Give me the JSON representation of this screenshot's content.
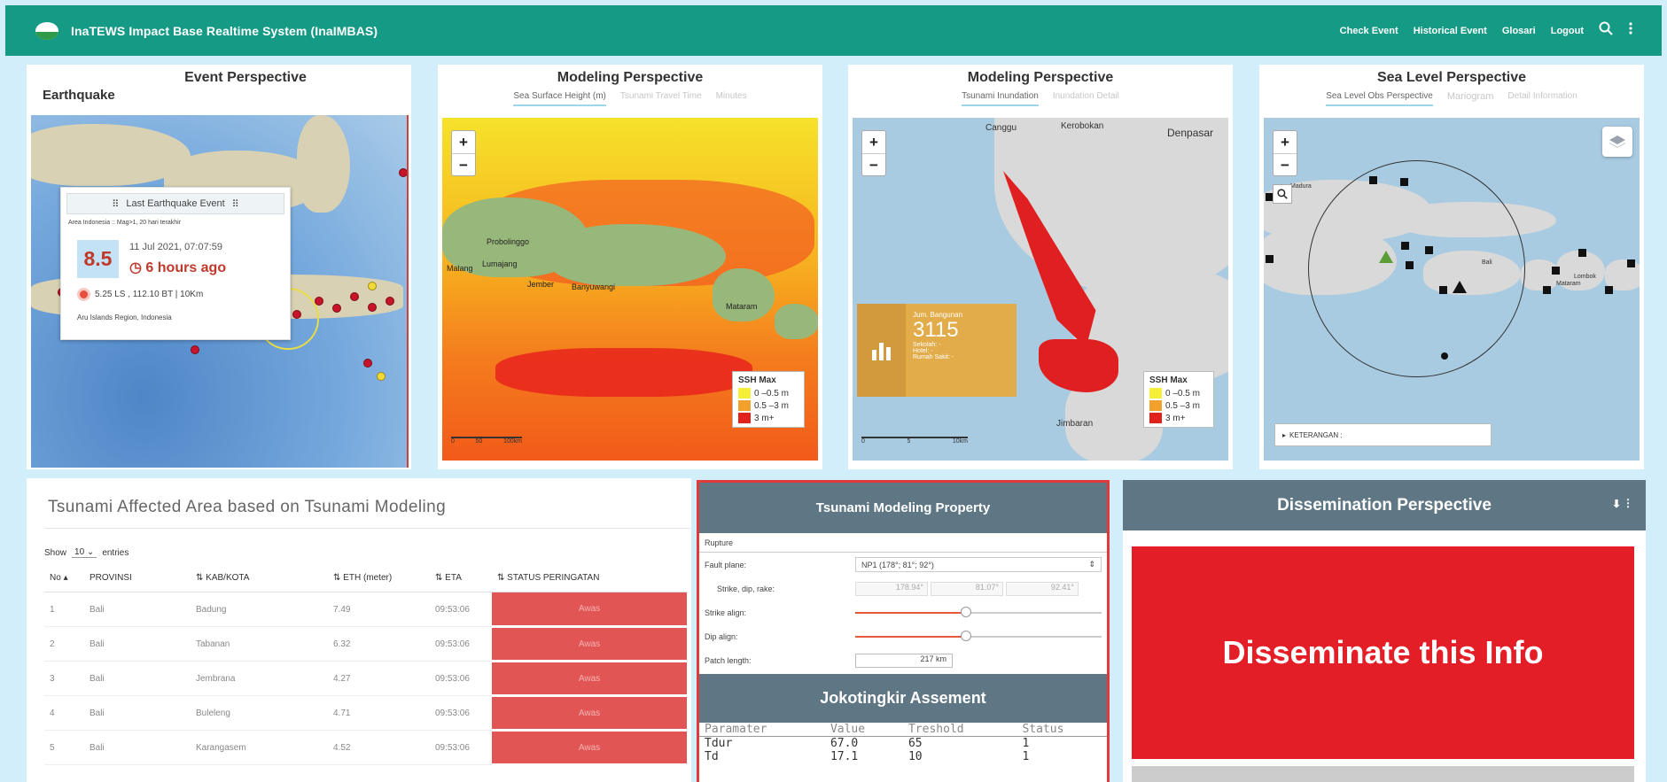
{
  "app": {
    "title": "InaTEWS Impact Base Realtime System (InaIMBAS)",
    "nav": [
      "Check Event",
      "Historical Event",
      "Glosari",
      "Logout"
    ]
  },
  "event_perspective": {
    "title": "Event Perspective",
    "tab": "Earthquake",
    "popup": {
      "header": "Last Earthquake Event",
      "subtitle": "Area Indonesia :: Mag>1, 20 hari terakhir",
      "magnitude": "8.5",
      "datetime": "11 Jul 2021, 07:07:59",
      "ago": "6 hours ago",
      "location": "5.25 LS , 112.10 BT | 10Km",
      "region": "Aru Islands Region, Indonesia"
    }
  },
  "modeling_ssh": {
    "title": "Modeling Perspective",
    "tabs": [
      "Sea Surface Height (m)",
      "Tsunami Travel Time",
      "Minutes"
    ],
    "places": [
      "Probolinggo",
      "Lumajang",
      "Jember",
      "Banyuwangi",
      "Mataram",
      "Malang"
    ],
    "legend": {
      "title": "SSH Max",
      "items": [
        "0 –0.5 m",
        "0.5 –3 m",
        "3 m+"
      ]
    },
    "scale_labels": [
      "0",
      "50",
      "100km"
    ]
  },
  "modeling_inundation": {
    "title": "Modeling Perspective",
    "tabs": [
      "Tsunami Inundation",
      "Inundation Detail"
    ],
    "places": [
      "Canggu",
      "Kerobokan",
      "Denpasar",
      "Jimbaran"
    ],
    "stat": {
      "label": "Jum. Bangunan",
      "value": "3115",
      "lines": [
        "Sekolah: -",
        "Hotel: -",
        "Rumah Sakit: -"
      ]
    },
    "legend": {
      "title": "SSH Max",
      "items": [
        "0 –0.5 m",
        "0.5 –3 m",
        "3 m+"
      ]
    },
    "scale_labels": [
      "0",
      "5",
      "10km"
    ]
  },
  "sea_level": {
    "title": "Sea Level Perspective",
    "tabs": [
      "Sea Level Obs Perspective",
      "Mariogram",
      "Detail Information"
    ],
    "places": [
      "Madura",
      "Bali",
      "Mataram",
      "Lombok"
    ],
    "keterangan": "KETERANGAN :"
  },
  "affected_area": {
    "title": "Tsunami Affected Area based on Tsunami Modeling",
    "show_label": "Show",
    "entries": "10",
    "entries_label": "entries",
    "columns": [
      "No",
      "PROVINSI",
      "KAB/KOTA",
      "ETH (meter)",
      "ETA",
      "STATUS PERINGATAN"
    ],
    "rows": [
      [
        "1",
        "Bali",
        "Badung",
        "7.49",
        "09:53:06",
        "Awas"
      ],
      [
        "2",
        "Bali",
        "Tabanan",
        "6.32",
        "09:53:06",
        "Awas"
      ],
      [
        "3",
        "Bali",
        "Jembrana",
        "4.27",
        "09:53:06",
        "Awas"
      ],
      [
        "4",
        "Bali",
        "Buleleng",
        "4.71",
        "09:53:06",
        "Awas"
      ],
      [
        "5",
        "Bali",
        "Karangasem",
        "4.52",
        "09:53:06",
        "Awas"
      ]
    ]
  },
  "tsunami_property": {
    "title": "Tsunami Modeling Property",
    "section": "Rupture",
    "fault_plane_label": "Fault plane:",
    "fault_plane_value": "NP1 (178°; 81°; 92°)",
    "sdr_label": "Strike, dip, rake:",
    "sdr_values": [
      "178.94°",
      "81.07°",
      "92.41°"
    ],
    "strike_align_label": "Strike align:",
    "strike_align_value": 0.45,
    "dip_align_label": "Dip align:",
    "dip_align_value": 0.45,
    "patch_length_label": "Patch length:",
    "patch_length_value": "217 km"
  },
  "jokotingkir": {
    "title": "Jokotingkir Assement",
    "columns": [
      "Paramater",
      "Value",
      "Treshold",
      "Status"
    ],
    "rows": [
      [
        "Tdur",
        "67.0",
        "65",
        "1"
      ],
      [
        "Td",
        "17.1",
        "10",
        "1"
      ]
    ]
  },
  "dissemination": {
    "title": "Dissemination Perspective",
    "button": "Disseminate this Info"
  },
  "colors": {
    "topbar": "#159a86",
    "alert_red": "#e41e26",
    "panel_header": "#5f7785",
    "status_red": "#e25555"
  }
}
